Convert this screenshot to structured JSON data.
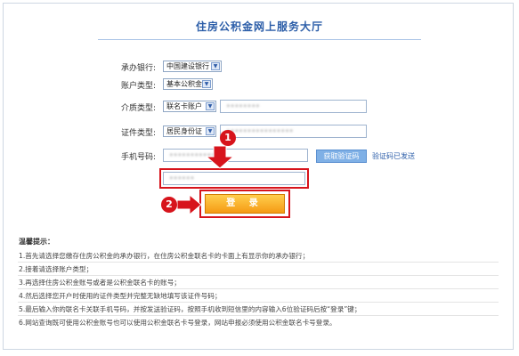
{
  "page": {
    "title": "住房公积金网上服务大厅"
  },
  "form": {
    "bank": {
      "label": "承办银行:",
      "value": "中国建设银行"
    },
    "account_type": {
      "label": "账户类型:",
      "value": "基本公积金"
    },
    "medium_type": {
      "label": "介质类型:",
      "value": "联名卡账户",
      "input_value": "••••••••"
    },
    "id_type": {
      "label": "证件类型:",
      "value": "居民身份证",
      "input_value": "••••••••••••••••"
    },
    "phone": {
      "label": "手机号码:",
      "input_value": "••••••••••••",
      "get_code_label": "获取验证码",
      "code_status": "验证码已发送"
    },
    "code_input_value": "••••••",
    "login_label": "登 录"
  },
  "annotations": {
    "badge_1": "1",
    "badge_2": "2"
  },
  "tips": {
    "title": "温馨提示：",
    "items": [
      "1.首先请选择您缴存住房公积金的承办银行，在住房公积金联名卡的卡面上有显示你的承办银行；",
      "2.接着请选择账户类型；",
      "3.再选择住房公积金账号或者是公积金联名卡的账号；",
      "4.然后选择您开户时使用的证件类型并完整无缺地填写该证件号码；",
      "5.最后输入你的联名卡关联手机号码，并按发送验证码，按照手机收到短信里的内容输入6位验证码后按“登录”键；",
      "6.网站查询既可使用公积金账号也可以使用公积金联名卡号登录，网站申报必须使用公积金联名卡号登录。"
    ]
  },
  "colors": {
    "accent": "#2b5da8",
    "highlight": "#d7141c",
    "login": "#f59a14"
  }
}
